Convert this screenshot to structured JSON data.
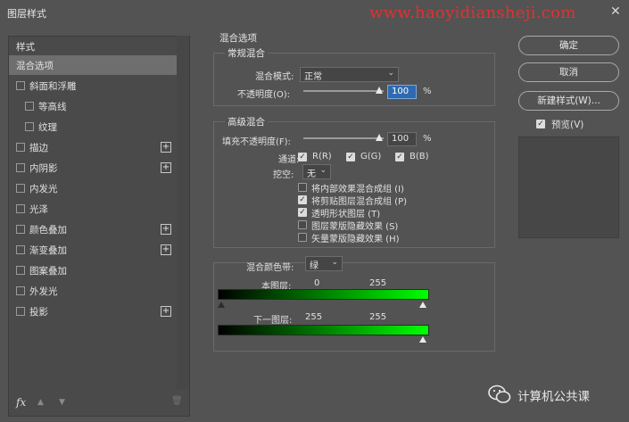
{
  "window": {
    "title": "图层样式",
    "watermark": "www.haoyidiansheji.com",
    "close": "✕"
  },
  "sidebar": {
    "header": "样式",
    "items": [
      {
        "label": "混合选项",
        "checkbox": false,
        "plus": false,
        "selected": true
      },
      {
        "label": "斜面和浮雕",
        "checkbox": true,
        "plus": false
      },
      {
        "label": "等高线",
        "checkbox": true,
        "plus": false,
        "indent": true
      },
      {
        "label": "纹理",
        "checkbox": true,
        "plus": false,
        "indent": true
      },
      {
        "label": "描边",
        "checkbox": true,
        "plus": true
      },
      {
        "label": "内阴影",
        "checkbox": true,
        "plus": true
      },
      {
        "label": "内发光",
        "checkbox": true,
        "plus": false
      },
      {
        "label": "光泽",
        "checkbox": true,
        "plus": false
      },
      {
        "label": "颜色叠加",
        "checkbox": true,
        "plus": true
      },
      {
        "label": "渐变叠加",
        "checkbox": true,
        "plus": true
      },
      {
        "label": "图案叠加",
        "checkbox": true,
        "plus": false
      },
      {
        "label": "外发光",
        "checkbox": true,
        "plus": false
      },
      {
        "label": "投影",
        "checkbox": true,
        "plus": true
      }
    ],
    "plus_symbol": "+",
    "fx_label": "fx",
    "up_icon": "▲",
    "down_icon": "▼",
    "trash_icon": "🗑"
  },
  "blend": {
    "section_title": "混合选项",
    "general": {
      "title": "常规混合",
      "mode_label": "混合模式:",
      "mode_value": "正常",
      "opacity_label": "不透明度(O):",
      "opacity_value": "100",
      "percent": "%"
    },
    "advanced": {
      "title": "高级混合",
      "fill_label": "填充不透明度(F):",
      "fill_value": "100",
      "percent": "%",
      "channels_label": "通道:",
      "channels": [
        "R(R)",
        "G(G)",
        "B(B)"
      ],
      "knockout_label": "挖空:",
      "knockout_value": "无",
      "options": [
        {
          "label": "将内部效果混合成组 (I)",
          "checked": false
        },
        {
          "label": "将剪贴图层混合成组 (P)",
          "checked": true
        },
        {
          "label": "透明形状图层 (T)",
          "checked": true
        },
        {
          "label": "图层蒙版隐藏效果 (S)",
          "checked": false
        },
        {
          "label": "矢量蒙版隐藏效果 (H)",
          "checked": false
        }
      ]
    },
    "blendif": {
      "label": "混合颜色带:",
      "value": "绿",
      "this_layer": {
        "label": "本图层:",
        "low": "0",
        "high": "255"
      },
      "underlying": {
        "label": "下一图层:",
        "low": "255",
        "high": "255"
      }
    }
  },
  "buttons": {
    "ok": "确定",
    "cancel": "取消",
    "new_style": "新建样式(W)...",
    "preview_label": "预览(V)",
    "check": "✓"
  },
  "wechat": {
    "label": "计算机公共课"
  },
  "colors": {
    "accent": "#2f6ab0",
    "watermark": "#e0322f",
    "gradient_end": "#00ff00"
  }
}
